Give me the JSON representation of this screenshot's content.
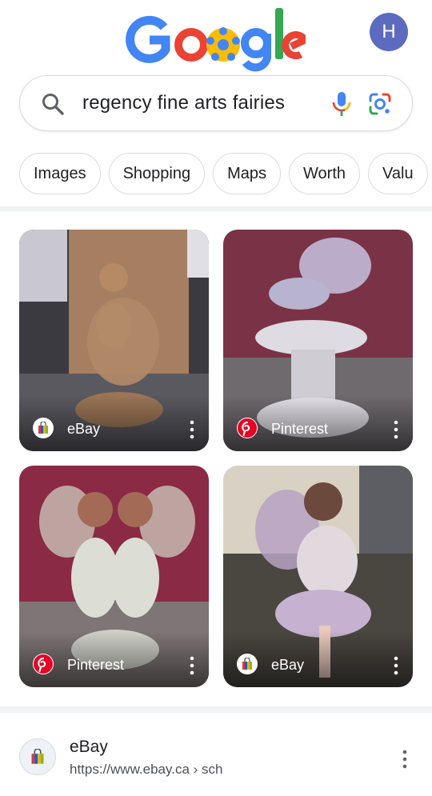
{
  "header": {
    "logo_alt": "Google",
    "avatar_initial": "H",
    "avatar_color": "#5c6bc0"
  },
  "search": {
    "query": "regency fine arts fairies",
    "icons": [
      "search-icon",
      "mic-icon",
      "lens-icon"
    ]
  },
  "chips": [
    "Images",
    "Shopping",
    "Maps",
    "Worth",
    "Valu"
  ],
  "images": [
    {
      "source": "eBay",
      "badge_icon": "ebay-bag-icon"
    },
    {
      "source": "Pinterest",
      "badge_icon": "pinterest-icon"
    },
    {
      "source": "Pinterest",
      "badge_icon": "pinterest-icon"
    },
    {
      "source": "eBay",
      "badge_icon": "ebay-bag-icon"
    }
  ],
  "result": {
    "site": "eBay",
    "url": "https://www.ebay.ca › sch",
    "favicon_icon": "ebay-bag-icon"
  },
  "colors": {
    "google_blue": "#4285F4",
    "google_red": "#EA4335",
    "google_yellow": "#FBBC05",
    "google_green": "#34A853",
    "pinterest_red": "#E60023"
  }
}
